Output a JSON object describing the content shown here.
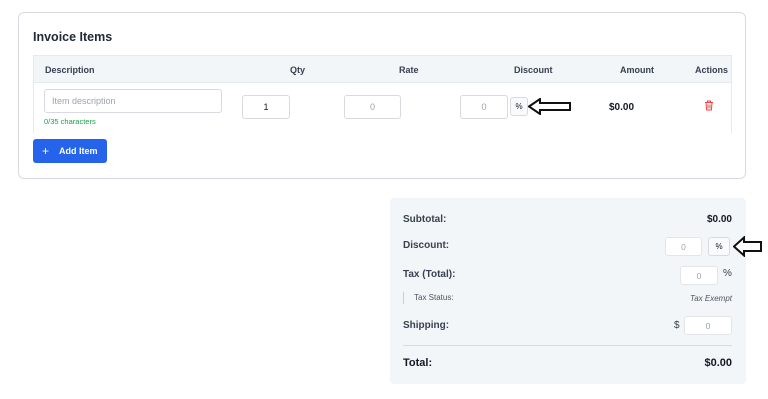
{
  "invoice_items": {
    "title": "Invoice Items",
    "columns": {
      "description": "Description",
      "qty": "Qty",
      "rate": "Rate",
      "discount": "Discount",
      "amount": "Amount",
      "actions": "Actions"
    },
    "rows": [
      {
        "description_placeholder": "Item description",
        "char_count": "0/35 characters",
        "qty": "1",
        "rate_placeholder": "0",
        "discount_placeholder": "0",
        "discount_unit": "%",
        "amount": "$0.00",
        "delete_icon": "trash-icon"
      }
    ],
    "add_item": {
      "icon": "+",
      "label": "Add Item"
    }
  },
  "summary": {
    "subtotal_label": "Subtotal:",
    "subtotal_value": "$0.00",
    "discount_label": "Discount:",
    "discount_placeholder": "0",
    "discount_unit": "%",
    "tax_label": "Tax (Total):",
    "tax_placeholder": "0",
    "tax_unit": "%",
    "tax_status_label": "Tax Status:",
    "tax_status_value": "Tax Exempt",
    "shipping_label": "Shipping:",
    "shipping_currency": "$",
    "shipping_placeholder": "0",
    "total_label": "Total:",
    "total_value": "$0.00"
  },
  "colors": {
    "primary": "#2563eb",
    "success_text": "#16a34a",
    "delete_icon": "#ef4444",
    "header_bg": "#f3f6f8"
  }
}
